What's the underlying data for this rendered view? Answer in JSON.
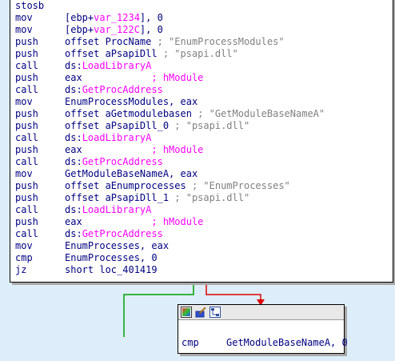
{
  "code_block": {
    "lines": [
      {
        "mnemonic": "stosb",
        "operand": ""
      },
      {
        "mnemonic": "mov",
        "operand": "[ebp+",
        "operand_var": "var_1234",
        "operand_tail": "], 0"
      },
      {
        "mnemonic": "mov",
        "operand": "[ebp+",
        "operand_var": "var_122C",
        "operand_tail": "], 0"
      },
      {
        "mnemonic": "push",
        "operand": "offset ProcName",
        "comment": " ; \"EnumProcessModules\""
      },
      {
        "mnemonic": "push",
        "operand": "offset aPsapiDll",
        "comment": " ; \"psapi.dll\""
      },
      {
        "mnemonic": "call",
        "operand": "ds:",
        "operand_import": "LoadLibraryA"
      },
      {
        "mnemonic": "push",
        "operand": "eax",
        "comment_pink": "            ; hModule"
      },
      {
        "mnemonic": "call",
        "operand": "ds:",
        "operand_import": "GetProcAddress"
      },
      {
        "mnemonic": "mov",
        "operand": "EnumProcessModules, eax"
      },
      {
        "mnemonic": "push",
        "operand": "offset aGetmodulebasen",
        "comment": " ; \"GetModuleBaseNameA\""
      },
      {
        "mnemonic": "push",
        "operand": "offset aPsapiDll_0",
        "comment": " ; \"psapi.dll\""
      },
      {
        "mnemonic": "call",
        "operand": "ds:",
        "operand_import": "LoadLibraryA"
      },
      {
        "mnemonic": "push",
        "operand": "eax",
        "comment_pink": "            ; hModule"
      },
      {
        "mnemonic": "call",
        "operand": "ds:",
        "operand_import": "GetProcAddress"
      },
      {
        "mnemonic": "mov",
        "operand": "GetModuleBaseNameA, eax"
      },
      {
        "mnemonic": "push",
        "operand": "offset aEnumprocesses",
        "comment": " ; \"EnumProcesses\""
      },
      {
        "mnemonic": "push",
        "operand": "offset aPsapiDll_1",
        "comment": " ; \"psapi.dll\""
      },
      {
        "mnemonic": "call",
        "operand": "ds:",
        "operand_import": "LoadLibraryA"
      },
      {
        "mnemonic": "push",
        "operand": "eax",
        "comment_pink": "            ; hModule"
      },
      {
        "mnemonic": "call",
        "operand": "ds:",
        "operand_import": "GetProcAddress"
      },
      {
        "mnemonic": "mov",
        "operand": "EnumProcesses, eax"
      },
      {
        "mnemonic": "cmp",
        "operand": "EnumProcesses, 0"
      },
      {
        "mnemonic": "jz",
        "operand": "short loc_401419"
      }
    ]
  },
  "bottom_block": {
    "toolbar_icons": [
      "graph-color-icon",
      "edit-icon",
      "graph-view-icon"
    ],
    "lines": [
      {
        "mnemonic": "cmp",
        "operand": "GetModuleBaseNameA, 0"
      }
    ]
  },
  "colors": {
    "background": "#ddeefa",
    "instruction": "#000080",
    "import_name": "#ff00ff",
    "comment": "#808080",
    "edge_false": "#00a000",
    "edge_true": "#e00000"
  }
}
